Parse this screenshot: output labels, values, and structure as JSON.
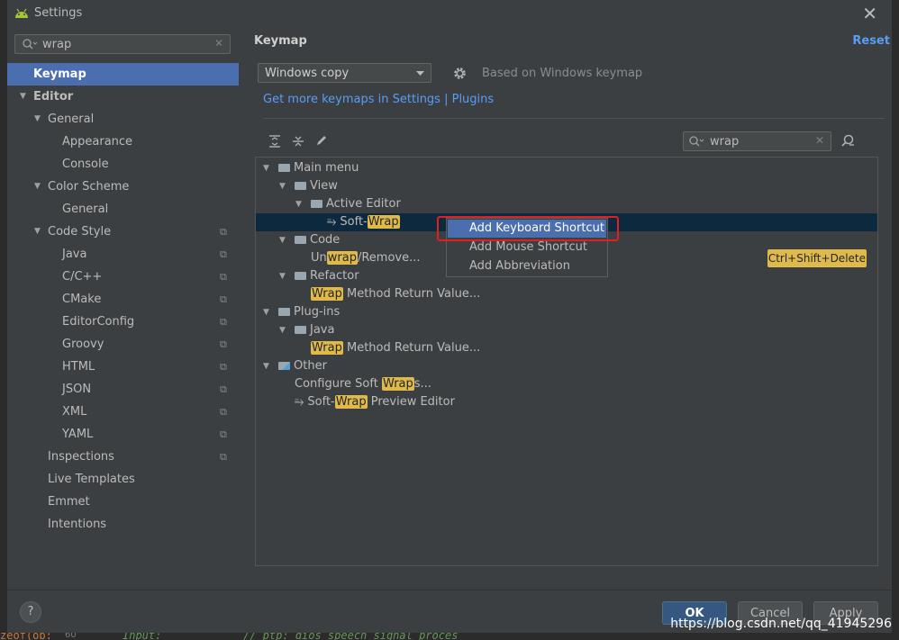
{
  "window": {
    "title": "Settings",
    "close_glyph": "✕"
  },
  "sidebar": {
    "search_value": "wrap",
    "clear_glyph": "✕",
    "items": [
      {
        "label": "Keymap",
        "level": 0,
        "selected": true,
        "expanded": null,
        "scope": false
      },
      {
        "label": "Editor",
        "level": 0,
        "selected": false,
        "expanded": true,
        "scope": false
      },
      {
        "label": "General",
        "level": 1,
        "selected": false,
        "expanded": true,
        "scope": false
      },
      {
        "label": "Appearance",
        "level": 2,
        "selected": false,
        "expanded": null,
        "scope": false
      },
      {
        "label": "Console",
        "level": 2,
        "selected": false,
        "expanded": null,
        "scope": false
      },
      {
        "label": "Color Scheme",
        "level": 1,
        "selected": false,
        "expanded": true,
        "scope": false
      },
      {
        "label": "General",
        "level": 2,
        "selected": false,
        "expanded": null,
        "scope": false
      },
      {
        "label": "Code Style",
        "level": 1,
        "selected": false,
        "expanded": true,
        "scope": true
      },
      {
        "label": "Java",
        "level": 2,
        "selected": false,
        "expanded": null,
        "scope": true
      },
      {
        "label": "C/C++",
        "level": 2,
        "selected": false,
        "expanded": null,
        "scope": true
      },
      {
        "label": "CMake",
        "level": 2,
        "selected": false,
        "expanded": null,
        "scope": true
      },
      {
        "label": "EditorConfig",
        "level": 2,
        "selected": false,
        "expanded": null,
        "scope": true
      },
      {
        "label": "Groovy",
        "level": 2,
        "selected": false,
        "expanded": null,
        "scope": true
      },
      {
        "label": "HTML",
        "level": 2,
        "selected": false,
        "expanded": null,
        "scope": true
      },
      {
        "label": "JSON",
        "level": 2,
        "selected": false,
        "expanded": null,
        "scope": true
      },
      {
        "label": "XML",
        "level": 2,
        "selected": false,
        "expanded": null,
        "scope": true
      },
      {
        "label": "YAML",
        "level": 2,
        "selected": false,
        "expanded": null,
        "scope": true
      },
      {
        "label": "Inspections",
        "level": 1,
        "selected": false,
        "expanded": null,
        "scope": true
      },
      {
        "label": "Live Templates",
        "level": 1,
        "selected": false,
        "expanded": null,
        "scope": false
      },
      {
        "label": "Emmet",
        "level": 1,
        "selected": false,
        "expanded": null,
        "scope": false
      },
      {
        "label": "Intentions",
        "level": 1,
        "selected": false,
        "expanded": null,
        "scope": false
      }
    ]
  },
  "main": {
    "header": "Keymap",
    "reset_label": "Reset",
    "keymap_value": "Windows copy",
    "based_on": "Based on Windows keymap",
    "get_more": "Get more keymaps in Settings | Plugins",
    "filter_value": "wrap",
    "tree": [
      {
        "indent": 0,
        "arrow": true,
        "icon": "folder",
        "parts": [
          {
            "t": "Main menu"
          }
        ],
        "shortcut": null,
        "selected": false
      },
      {
        "indent": 1,
        "arrow": true,
        "icon": "folder",
        "parts": [
          {
            "t": "View"
          }
        ],
        "shortcut": null,
        "selected": false
      },
      {
        "indent": 2,
        "arrow": true,
        "icon": "folder",
        "parts": [
          {
            "t": "Active Editor"
          }
        ],
        "shortcut": null,
        "selected": false
      },
      {
        "indent": 3,
        "arrow": false,
        "icon": "wrap",
        "parts": [
          {
            "t": "Soft-"
          },
          {
            "t": "Wrap",
            "hl": true
          }
        ],
        "shortcut": null,
        "selected": true
      },
      {
        "indent": 1,
        "arrow": true,
        "icon": "folder",
        "parts": [
          {
            "t": "Code"
          }
        ],
        "shortcut": null,
        "selected": false
      },
      {
        "indent": 2,
        "arrow": false,
        "icon": null,
        "parts": [
          {
            "t": "Un"
          },
          {
            "t": "wrap",
            "hl": true
          },
          {
            "t": "/Remove..."
          }
        ],
        "shortcut": "Ctrl+Shift+Delete",
        "selected": false
      },
      {
        "indent": 1,
        "arrow": true,
        "icon": "folder",
        "parts": [
          {
            "t": "Refactor"
          }
        ],
        "shortcut": null,
        "selected": false
      },
      {
        "indent": 2,
        "arrow": false,
        "icon": null,
        "parts": [
          {
            "t": "Wrap",
            "hl": true
          },
          {
            "t": " Method Return Value..."
          }
        ],
        "shortcut": null,
        "selected": false
      },
      {
        "indent": 0,
        "arrow": true,
        "icon": "folder",
        "parts": [
          {
            "t": "Plug-ins"
          }
        ],
        "shortcut": null,
        "selected": false
      },
      {
        "indent": 1,
        "arrow": true,
        "icon": "folder",
        "parts": [
          {
            "t": "Java"
          }
        ],
        "shortcut": null,
        "selected": false
      },
      {
        "indent": 2,
        "arrow": false,
        "icon": null,
        "parts": [
          {
            "t": "Wrap",
            "hl": true
          },
          {
            "t": " Method Return Value..."
          }
        ],
        "shortcut": null,
        "selected": false
      },
      {
        "indent": 0,
        "arrow": true,
        "icon": "folder-other",
        "parts": [
          {
            "t": "Other"
          }
        ],
        "shortcut": null,
        "selected": false
      },
      {
        "indent": 1,
        "arrow": false,
        "icon": null,
        "parts": [
          {
            "t": "Configure Soft "
          },
          {
            "t": "Wrap",
            "hl": true
          },
          {
            "t": "s..."
          }
        ],
        "shortcut": null,
        "selected": false
      },
      {
        "indent": 1,
        "arrow": false,
        "icon": "wrap",
        "parts": [
          {
            "t": "Soft-"
          },
          {
            "t": "Wrap",
            "hl": true
          },
          {
            "t": " Preview Editor"
          }
        ],
        "shortcut": null,
        "selected": false
      }
    ],
    "context_menu": [
      {
        "label": "Add Keyboard Shortcut",
        "selected": true
      },
      {
        "label": "Add Mouse Shortcut",
        "selected": false
      },
      {
        "label": "Add Abbreviation",
        "selected": false
      }
    ]
  },
  "footer": {
    "help": "?",
    "ok": "OK",
    "cancel": "Cancel",
    "apply": "Apply"
  },
  "watermark": "https://blog.csdn.net/qq_41945296",
  "editor_behind": {
    "left": "zeof(ob:",
    "hint": "60",
    "middle": "Input:",
    "comment": "// ptp: dios speech signal proces"
  },
  "colors": {
    "selection": "#4b6eaf",
    "highlight": "#dfba4a",
    "link": "#589df6",
    "callout": "#e02020"
  }
}
